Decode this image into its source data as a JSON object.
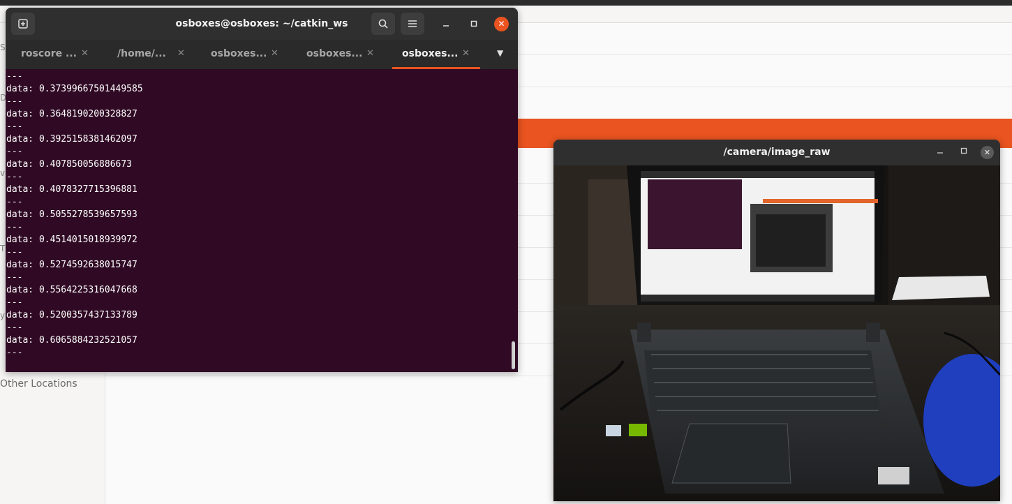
{
  "file_manager": {
    "sidebar_other_locations": "Other Locations"
  },
  "terminal": {
    "title": "osboxes@osboxes: ~/catkin_ws",
    "new_tab_icon": "new-tab-icon",
    "tabs": [
      {
        "label": "roscore ...",
        "active": false
      },
      {
        "label": "/home/...",
        "active": false
      },
      {
        "label": "osboxes...",
        "active": false
      },
      {
        "label": "osboxes...",
        "active": false
      },
      {
        "label": "osboxes...",
        "active": true
      }
    ],
    "lines": [
      "---",
      "data: 0.37399667501449585",
      "---",
      "data: 0.3648190200328827",
      "---",
      "data: 0.3925158381462097",
      "---",
      "data: 0.407850056886673",
      "---",
      "data: 0.4078327715396881",
      "---",
      "data: 0.5055278539657593",
      "---",
      "data: 0.4514015018939972",
      "---",
      "data: 0.5274592638015747",
      "---",
      "data: 0.5564225316047668",
      "---",
      "data: 0.5200357437133789",
      "---",
      "data: 0.6065884232521057",
      "---"
    ]
  },
  "camera_window": {
    "title": "/camera/image_raw"
  },
  "colors": {
    "terminal_bg": "#300a24",
    "accent": "#e95420"
  }
}
